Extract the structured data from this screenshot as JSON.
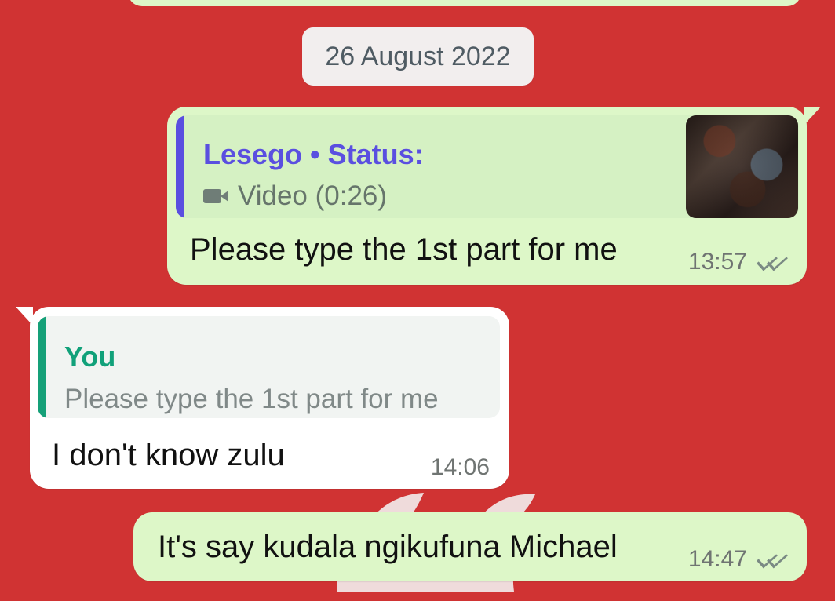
{
  "chat": {
    "date_label": "26 August 2022",
    "messages": [
      {
        "reply": {
          "title": "Lesego • Status:",
          "subtitle": "Video (0:26)"
        },
        "text": "Please type the 1st part for me",
        "time": "13:57",
        "status": "read"
      },
      {
        "reply": {
          "title": "You",
          "subtitle": "Please type the 1st part for me"
        },
        "text": "I don't know zulu",
        "time": "14:06"
      },
      {
        "text": "It's say kudala ngikufuna Michael",
        "time": "14:47",
        "status": "read"
      }
    ]
  },
  "icons": {
    "video": "video-icon",
    "delivered": "double-check-icon"
  },
  "colors": {
    "background": "#d03333",
    "outgoing_bubble": "#ddf7c8",
    "incoming_bubble": "#ffffff",
    "status_reply_accent": "#5a4fe0",
    "self_reply_accent": "#15a078"
  }
}
